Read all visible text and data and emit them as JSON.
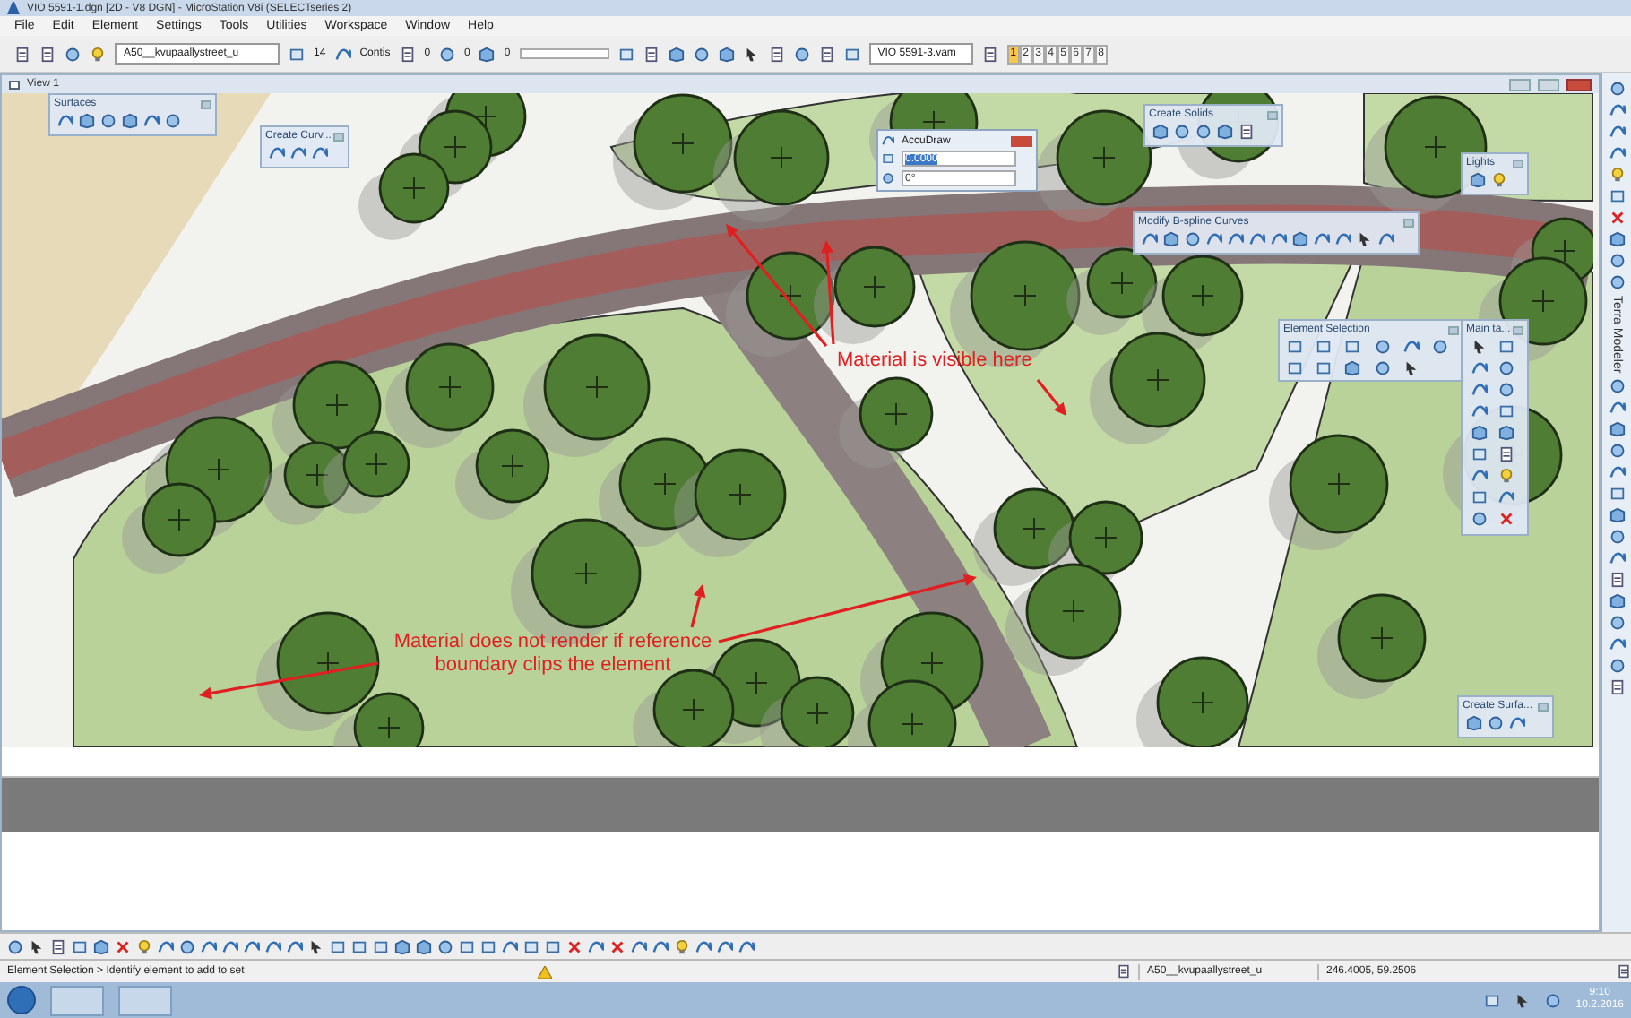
{
  "window": {
    "title": "VIO 5591-1.dgn [2D - V8 DGN] - MicroStation V8i (SELECTseries 2)"
  },
  "menu": [
    "File",
    "Edit",
    "Element",
    "Settings",
    "Tools",
    "Utilities",
    "Workspace",
    "Window",
    "Help"
  ],
  "toolbar": {
    "level_combo": "A50__kvupaallystreet_u",
    "weight": "14",
    "style": "Contis",
    "values": [
      "0",
      "0",
      "0"
    ],
    "model_combo": "VIO 5591-3.vam"
  },
  "view_buttons": [
    {
      "label": "1",
      "selected": true
    },
    {
      "label": "2",
      "selected": false
    },
    {
      "label": "3",
      "selected": false
    },
    {
      "label": "4",
      "selected": false
    },
    {
      "label": "5",
      "selected": false
    },
    {
      "label": "6",
      "selected": false
    },
    {
      "label": "7",
      "selected": false
    },
    {
      "label": "8",
      "selected": false
    }
  ],
  "view": {
    "title": "View 1",
    "annotations": [
      "Material is visible here",
      "Material does not render if reference boundary clips the element"
    ]
  },
  "toolboxes": [
    {
      "title": "Surfaces"
    },
    {
      "title": "Create Curv..."
    },
    {
      "title": "Create Solids"
    },
    {
      "title": "Lights"
    },
    {
      "title": "Modify B-spline Curves"
    },
    {
      "title": "Element Selection"
    },
    {
      "title": "Main ta..."
    },
    {
      "title": "Create Surfa..."
    }
  ],
  "accudraw": {
    "title": "AccuDraw",
    "distance": "0.0000",
    "angle": "0°"
  },
  "side_toolbar": {
    "label": "Terra Modeler"
  },
  "status_bar": {
    "prompt": "Element Selection > Identify element to add to set",
    "level": "A50__kvupaallystreet_u",
    "coordinates": "246.4005, 59.2506"
  },
  "taskbar": {
    "time": "9:10",
    "date": "10.2.2016"
  }
}
